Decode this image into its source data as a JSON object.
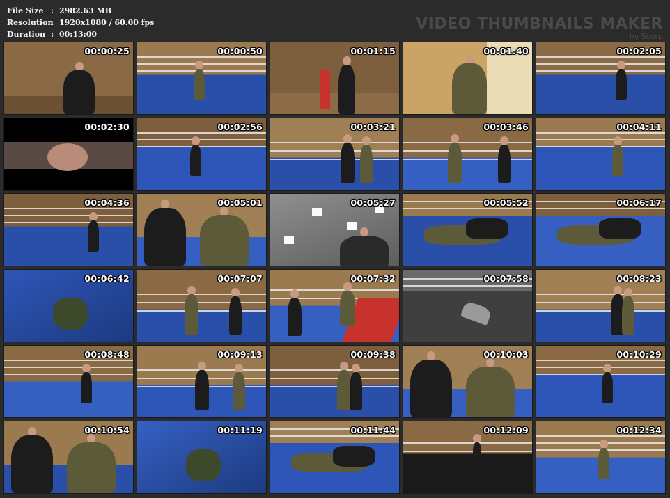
{
  "info": {
    "rows": [
      {
        "key": "File Size",
        "value": "2982.63 MB"
      },
      {
        "key": "Resolution",
        "value": "1920x1080 / 60.00 fps"
      },
      {
        "key": "Duration",
        "value": "00:13:00"
      }
    ],
    "separator": ":"
  },
  "brand": {
    "title": "VIDEO THUMBNAILS MAKER",
    "by": "by Scorp"
  },
  "thumbnails": [
    {
      "time": "00:00:25",
      "scene": "wall-close"
    },
    {
      "time": "00:00:50",
      "scene": "ring-wide"
    },
    {
      "time": "00:01:15",
      "scene": "wall-pad"
    },
    {
      "time": "00:01:40",
      "scene": "back-close"
    },
    {
      "time": "00:02:05",
      "scene": "ring-wide"
    },
    {
      "time": "00:02:30",
      "scene": "letterbox"
    },
    {
      "time": "00:02:56",
      "scene": "ring-wide"
    },
    {
      "time": "00:03:21",
      "scene": "ring-mid"
    },
    {
      "time": "00:03:46",
      "scene": "ring-mid"
    },
    {
      "time": "00:04:11",
      "scene": "ring-wide"
    },
    {
      "time": "00:04:36",
      "scene": "ring-wide"
    },
    {
      "time": "00:05:01",
      "scene": "two-close"
    },
    {
      "time": "00:05:27",
      "scene": "ceiling"
    },
    {
      "time": "00:05:52",
      "scene": "floor-grapple"
    },
    {
      "time": "00:06:17",
      "scene": "floor-grapple"
    },
    {
      "time": "00:06:42",
      "scene": "mat-close"
    },
    {
      "time": "00:07:07",
      "scene": "ring-mid"
    },
    {
      "time": "00:07:32",
      "scene": "ring-red"
    },
    {
      "time": "00:07:58",
      "scene": "gray"
    },
    {
      "time": "00:08:23",
      "scene": "ring-mid"
    },
    {
      "time": "00:08:48",
      "scene": "ring-wide"
    },
    {
      "time": "00:09:13",
      "scene": "ring-mid"
    },
    {
      "time": "00:09:38",
      "scene": "ring-mid"
    },
    {
      "time": "00:10:03",
      "scene": "two-close"
    },
    {
      "time": "00:10:29",
      "scene": "ring-wide"
    },
    {
      "time": "00:10:54",
      "scene": "two-close"
    },
    {
      "time": "00:11:19",
      "scene": "mat-close"
    },
    {
      "time": "00:11:44",
      "scene": "floor-grapple"
    },
    {
      "time": "00:12:09",
      "scene": "dark-ring"
    },
    {
      "time": "00:12:34",
      "scene": "ring-wide"
    }
  ]
}
